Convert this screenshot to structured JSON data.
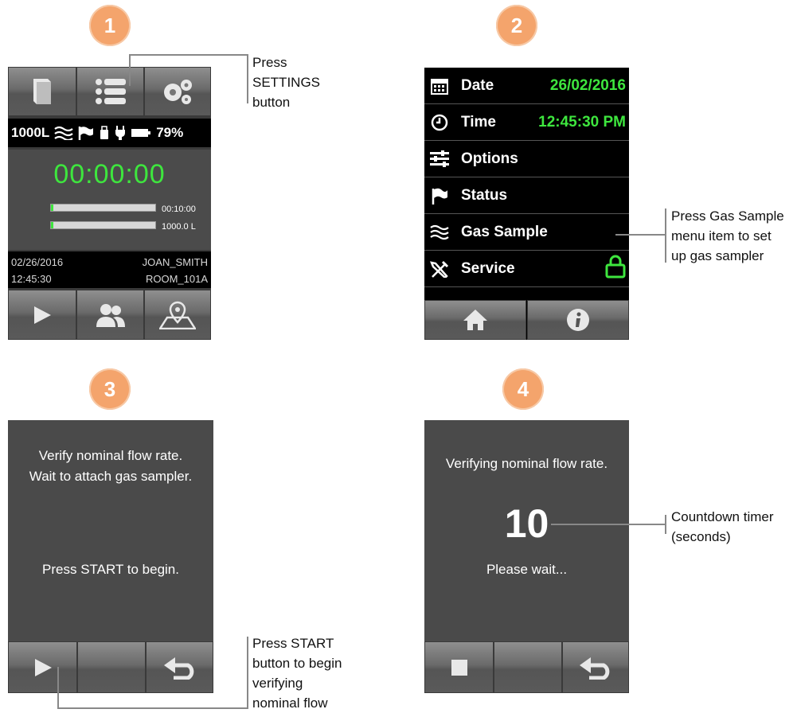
{
  "steps": [
    "1",
    "2",
    "3",
    "4"
  ],
  "screen1": {
    "status": {
      "volume": "1000L",
      "battery": "79%"
    },
    "timer": "00:00:00",
    "bars": [
      {
        "label": "00:10:00",
        "progress": 0.02
      },
      {
        "label": "1000.0 L",
        "progress": 0.02
      }
    ],
    "info": {
      "date": "02/26/2016",
      "time": "12:45:30",
      "user": "JOAN_SMITH",
      "room": "ROOM_101A"
    },
    "top_buttons": [
      "book-icon",
      "list-icon",
      "gears-icon"
    ],
    "bottom_buttons": [
      "play-icon",
      "people-icon",
      "map-pin-icon"
    ]
  },
  "screen2": {
    "menu": [
      {
        "label": "Date",
        "value": "26/02/2016",
        "icon": "calendar-icon"
      },
      {
        "label": "Time",
        "value": "12:45:30 PM",
        "icon": "clock-icon"
      },
      {
        "label": "Options",
        "value": "",
        "icon": "sliders-icon"
      },
      {
        "label": "Status",
        "value": "",
        "icon": "flag-icon"
      },
      {
        "label": "Gas Sample",
        "value": "",
        "icon": "waves-icon"
      },
      {
        "label": "Service",
        "value": "",
        "icon": "tools-icon"
      }
    ],
    "bottom_buttons": [
      "home-icon",
      "info-icon"
    ]
  },
  "screen3": {
    "line1": "Verify nominal flow rate.",
    "line2": "Wait to attach gas sampler.",
    "line3": "Press START to begin."
  },
  "screen4": {
    "line1": "Verifying nominal flow rate.",
    "countdown": "10",
    "line2": "Please wait..."
  },
  "callouts": {
    "c1": [
      "Press",
      "SETTINGS",
      "button"
    ],
    "c2": [
      "Press Gas Sample",
      "menu item to set",
      "up gas sampler"
    ],
    "c3": [
      "Press START",
      "button to begin",
      "verifying",
      "nominal flow"
    ],
    "c4": [
      "Countdown timer",
      "(seconds)"
    ]
  },
  "colors": {
    "badge": "#f4a46c",
    "green": "#3ee63e",
    "screen": "#4a4a4a"
  }
}
